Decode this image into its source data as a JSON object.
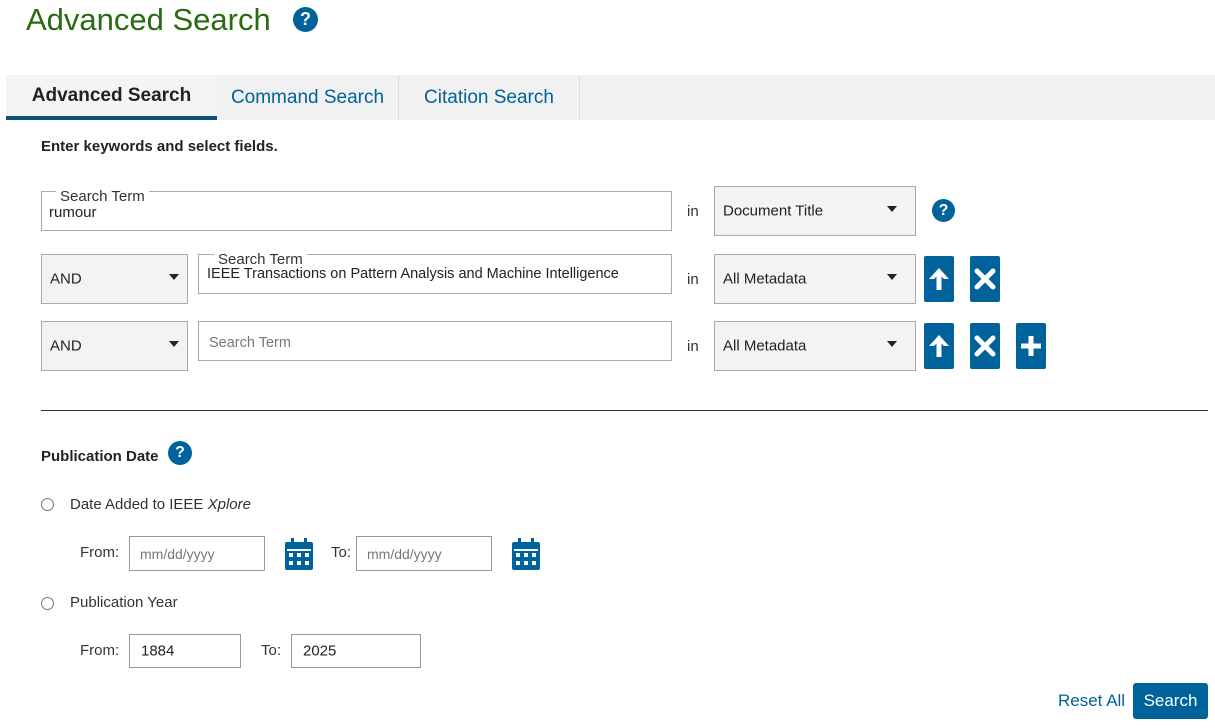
{
  "page": {
    "title": "Advanced Search",
    "help_glyph": "?"
  },
  "tabs": [
    {
      "label": "Advanced Search",
      "active": true
    },
    {
      "label": "Command Search",
      "active": false
    },
    {
      "label": "Citation Search",
      "active": false
    }
  ],
  "instructions": "Enter keywords and select fields.",
  "rows": [
    {
      "operator": null,
      "term_label": "Search Term",
      "term_value": "rumour",
      "in_label": "in",
      "field": "Document Title"
    },
    {
      "operator": "AND",
      "term_label": "Search Term",
      "term_value": "IEEE Transactions on Pattern Analysis and Machine Intelligence",
      "in_label": "in",
      "field": "All Metadata"
    },
    {
      "operator": "AND",
      "term_placeholder": "Search Term",
      "term_value": "",
      "in_label": "in",
      "field": "All Metadata"
    }
  ],
  "publication_date": {
    "heading": "Publication Date",
    "date_added": {
      "label_prefix": "Date Added to IEEE ",
      "label_italic": "Xplore",
      "from_label": "From:",
      "to_label": "To:",
      "from_placeholder": "mm/dd/yyyy",
      "to_placeholder": "mm/dd/yyyy"
    },
    "publication_year": {
      "label": "Publication Year",
      "from_label": "From:",
      "to_label": "To:",
      "from_value": "1884",
      "to_value": "2025"
    }
  },
  "actions": {
    "reset": "Reset All",
    "search": "Search"
  },
  "colors": {
    "primary": "#00629b",
    "title_green": "#2a6a12"
  }
}
